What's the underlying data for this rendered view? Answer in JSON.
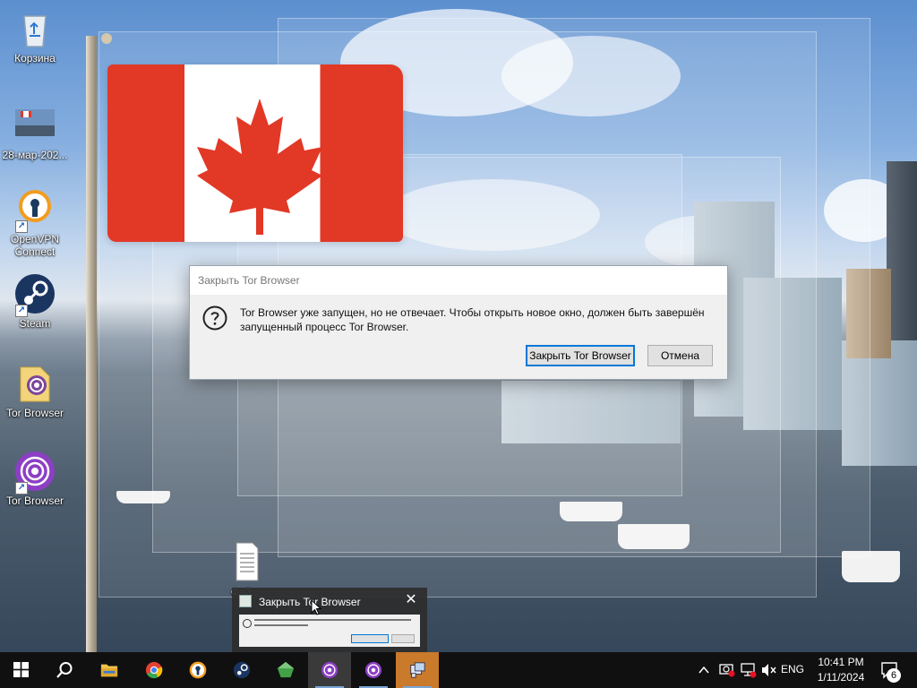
{
  "desktop": {
    "icons": [
      {
        "label": "Корзина",
        "icon": "recycle-bin-icon"
      },
      {
        "label": "28-мар-202...",
        "icon": "photo-thumbnail-icon"
      },
      {
        "label": "OpenVPN Connect",
        "icon": "openvpn-icon"
      },
      {
        "label": "Steam",
        "icon": "steam-icon"
      },
      {
        "label": "Tor Browser",
        "icon": "tor-folder-icon"
      },
      {
        "label": "Tor Browser",
        "icon": "tor-browser-icon"
      }
    ],
    "file_label": "Фай..."
  },
  "dialog": {
    "title": "Закрыть Tor Browser",
    "icon": "question-icon",
    "message": "Tor Browser уже запущен, но не отвечает. Чтобы открыть новое окно, должен быть завершён запущенный процесс Tor Browser.",
    "primary_button": "Закрыть Tor Browser",
    "cancel_button": "Отмена"
  },
  "taskbar_preview": {
    "title": "Закрыть Tor Browser",
    "close_glyph": "✕"
  },
  "taskbar": {
    "apps": [
      {
        "name": "start-button",
        "icon": "windows-logo-icon"
      },
      {
        "name": "search-button",
        "icon": "search-icon"
      },
      {
        "name": "file-explorer",
        "icon": "folder-icon"
      },
      {
        "name": "chrome",
        "icon": "chrome-icon"
      },
      {
        "name": "openvpn",
        "icon": "openvpn-icon"
      },
      {
        "name": "steam",
        "icon": "steam-icon"
      },
      {
        "name": "green-app",
        "icon": "green-gem-icon"
      },
      {
        "name": "tor-browser-1",
        "icon": "tor-browser-icon"
      },
      {
        "name": "tor-browser-2",
        "icon": "tor-browser-icon"
      },
      {
        "name": "dialog-app",
        "icon": "dialog-window-icon"
      }
    ],
    "tray": {
      "language": "ENG",
      "time": "10:41 PM",
      "date": "1/11/2024",
      "notification_count": "6"
    }
  }
}
